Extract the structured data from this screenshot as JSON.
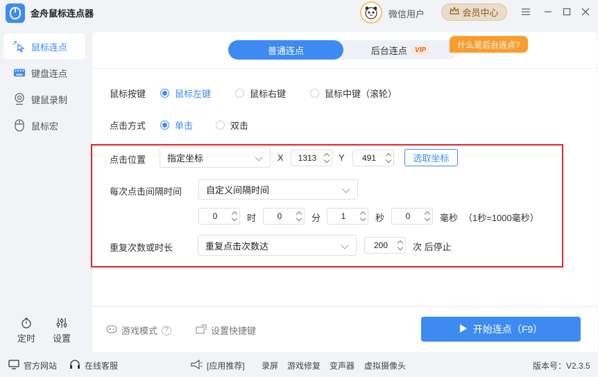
{
  "app": {
    "title": "金舟鼠标连点器",
    "user_name": "微信用户",
    "vip_center": "会员中心"
  },
  "sidebar": {
    "items": [
      {
        "label": "鼠标连点",
        "icon": "mouse-click-icon"
      },
      {
        "label": "键盘连点",
        "icon": "keyboard-icon"
      },
      {
        "label": "键鼠录制",
        "icon": "record-icon"
      },
      {
        "label": "鼠标宏",
        "icon": "mouse-icon"
      }
    ],
    "tools": [
      {
        "label": "定时",
        "icon": "timer-icon"
      },
      {
        "label": "设置",
        "icon": "settings-sliders-icon"
      }
    ]
  },
  "tabs": {
    "normal": "普通连点",
    "background": "后台连点",
    "vip_tag": "VIP",
    "tip": "什么是后台连点?"
  },
  "mouse_button": {
    "label": "鼠标按键",
    "options": [
      "鼠标左键",
      "鼠标右键",
      "鼠标中键（滚轮）"
    ],
    "selected": 0
  },
  "click_mode": {
    "label": "点击方式",
    "options": [
      "单击",
      "双击"
    ],
    "selected": 0
  },
  "position": {
    "label": "点击位置",
    "mode": "指定坐标",
    "x_label": "X",
    "x_value": "1313",
    "y_label": "Y",
    "y_value": "491",
    "pick_button": "选取坐标"
  },
  "interval": {
    "label": "每次点击间隔时间",
    "mode": "自定义间隔时间",
    "hours": "0",
    "hours_unit": "时",
    "minutes": "0",
    "minutes_unit": "分",
    "seconds": "1",
    "seconds_unit": "秒",
    "ms": "0",
    "ms_unit": "毫秒",
    "note": "（1秒=1000毫秒）"
  },
  "repeat": {
    "label": "重复次数或时长",
    "mode": "重复点击次数达",
    "count": "200",
    "suffix": "次 后停止"
  },
  "footer": {
    "game_mode": "游戏模式",
    "help": "?",
    "hotkey": "设置快捷键",
    "start": "开始连点（F9）"
  },
  "statusbar": {
    "website": "官方网站",
    "service": "在线客服",
    "recommend": "[应用推荐]",
    "apps": [
      "录屏",
      "游戏修复",
      "变声器",
      "虚拟摄像头"
    ],
    "version": "版本号：V2.3.5"
  },
  "colors": {
    "accent": "#3d8bf2",
    "highlight": "#e0232b",
    "tip": "#fb9c2e"
  }
}
